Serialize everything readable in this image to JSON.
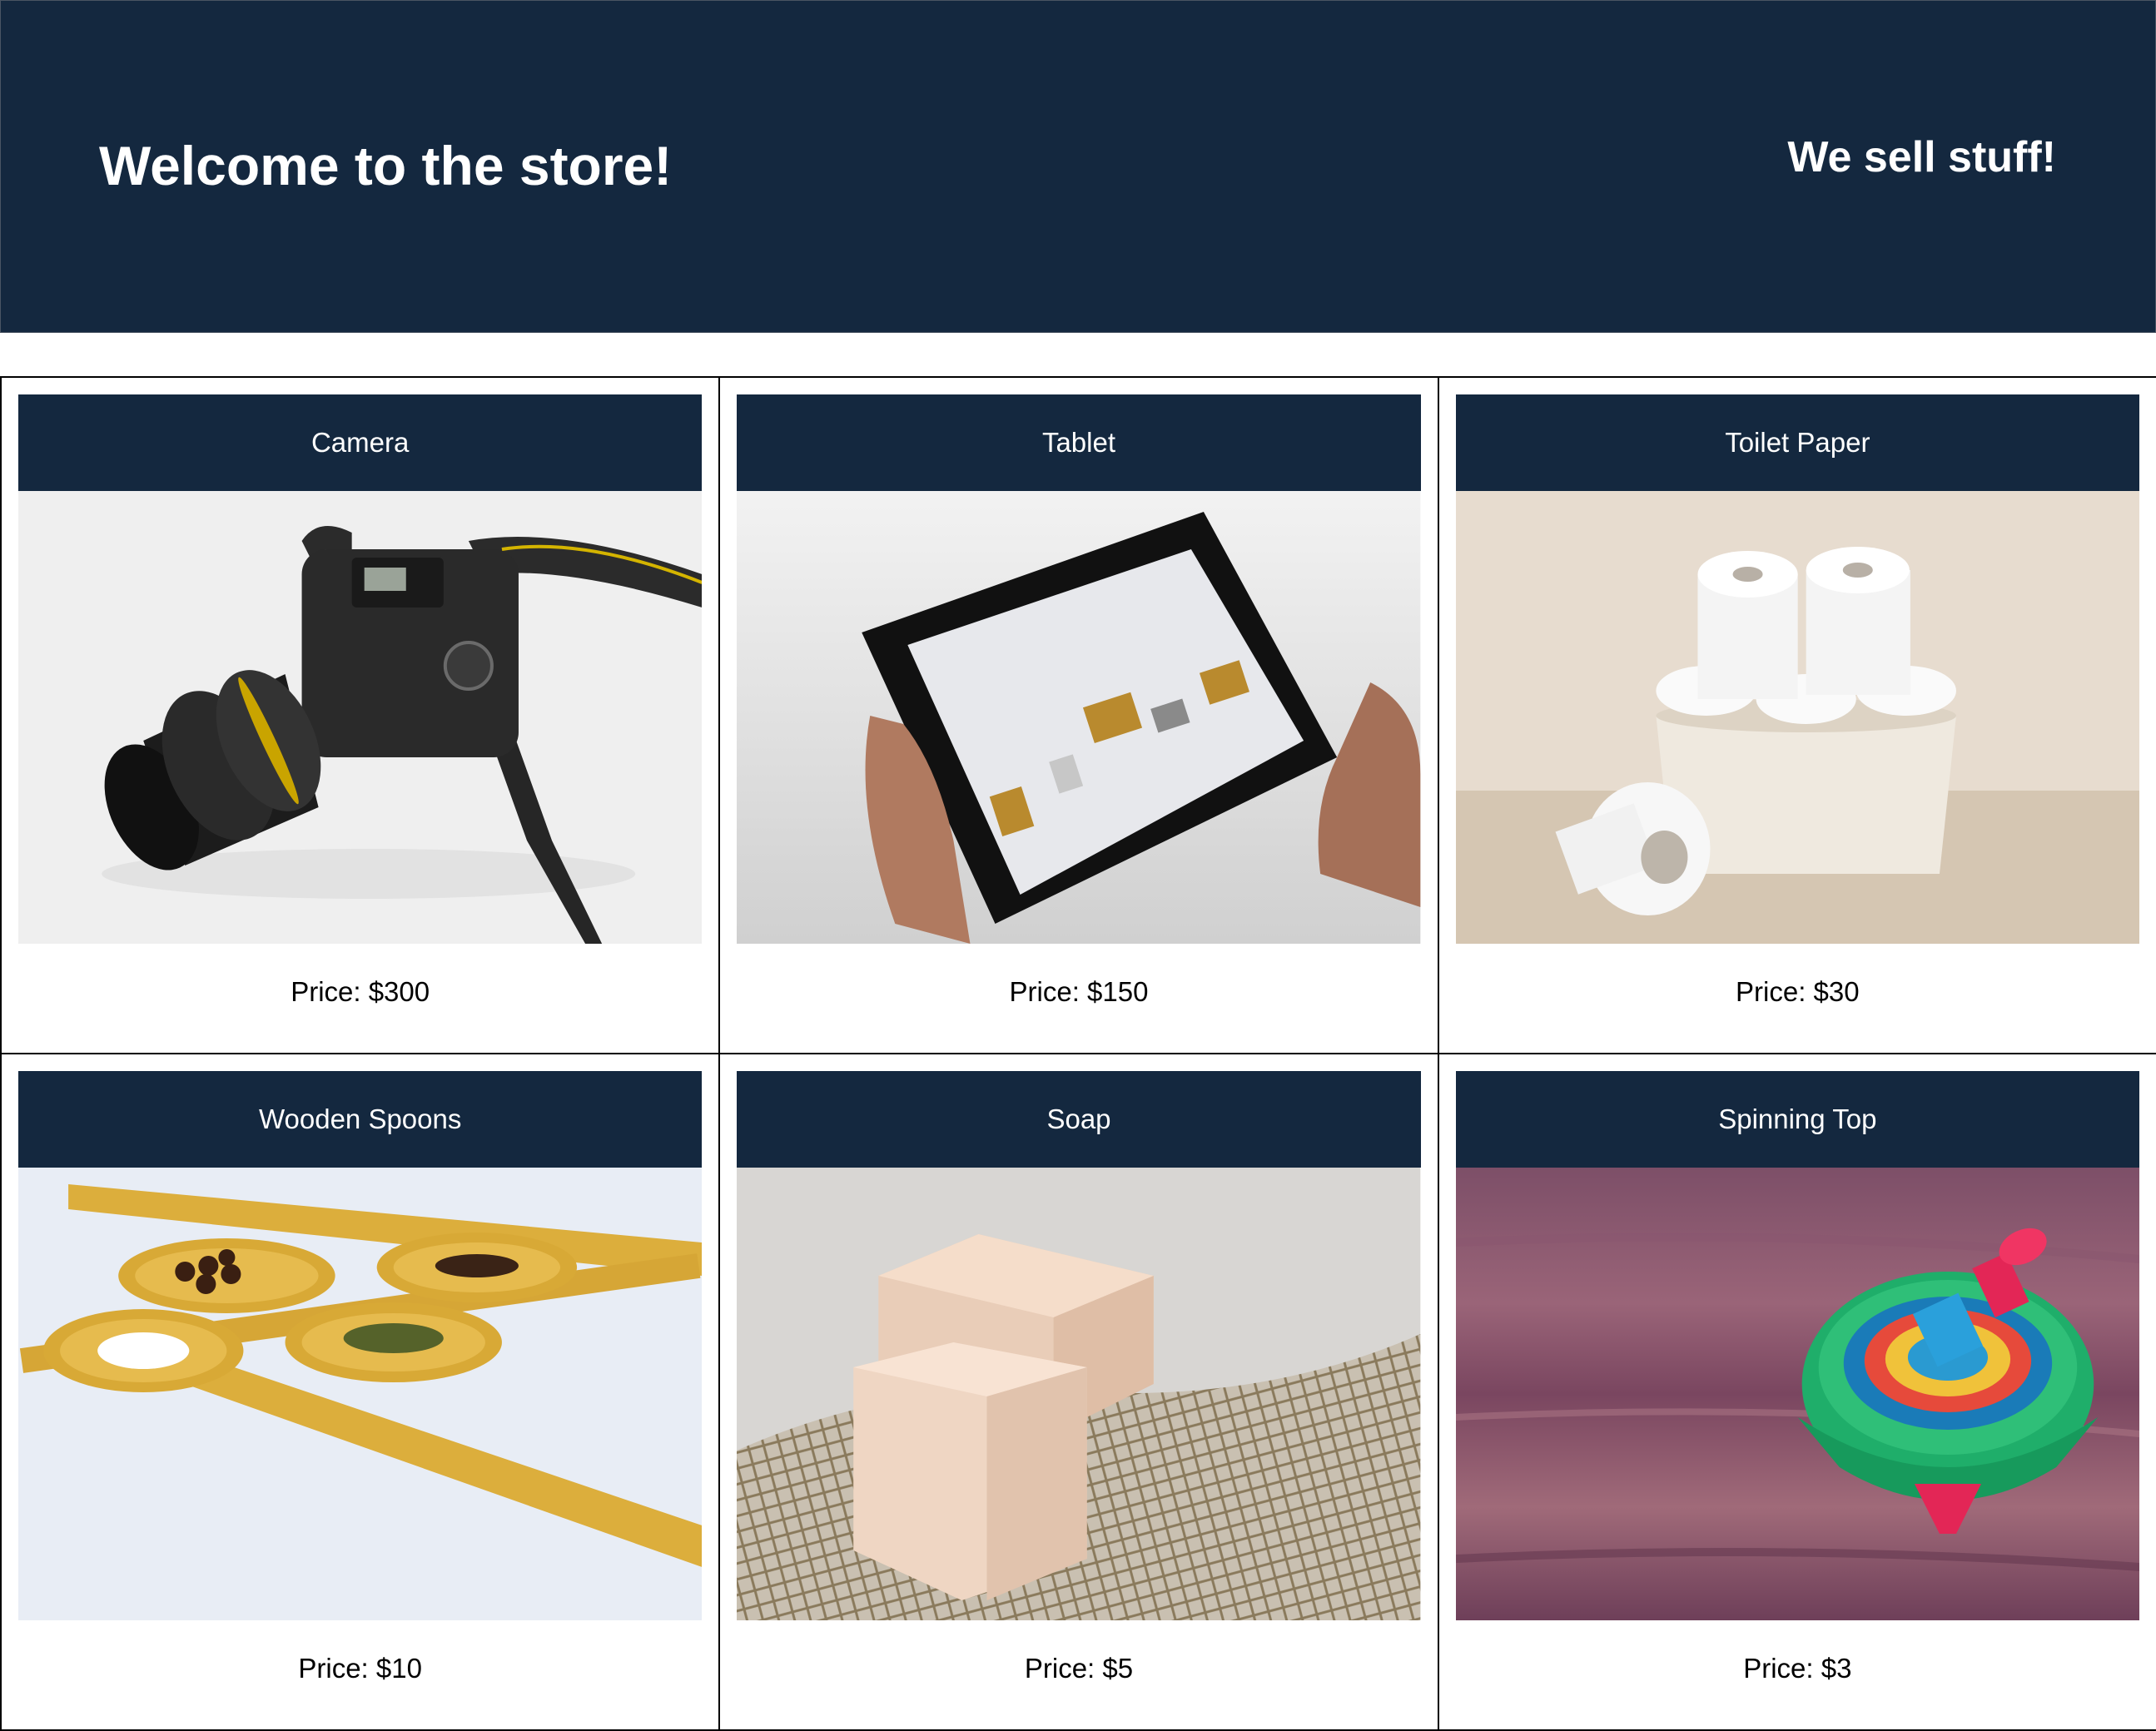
{
  "header": {
    "title": "Welcome to the store!",
    "tagline": "We sell stuff!"
  },
  "colors": {
    "header_bg": "#14283f",
    "card_border": "#000000"
  },
  "products": [
    {
      "name": "Camera",
      "price": "Price: $300",
      "image": "camera-photo"
    },
    {
      "name": "Tablet",
      "price": "Price: $150",
      "image": "tablet-photo"
    },
    {
      "name": "Toilet Paper",
      "price": "Price: $30",
      "image": "toilet-paper-photo"
    },
    {
      "name": "Wooden Spoons",
      "price": "Price: $10",
      "image": "wooden-spoons-photo"
    },
    {
      "name": "Soap",
      "price": "Price: $5",
      "image": "soap-photo"
    },
    {
      "name": "Spinning Top",
      "price": "Price: $3",
      "image": "spinning-top-photo"
    }
  ]
}
